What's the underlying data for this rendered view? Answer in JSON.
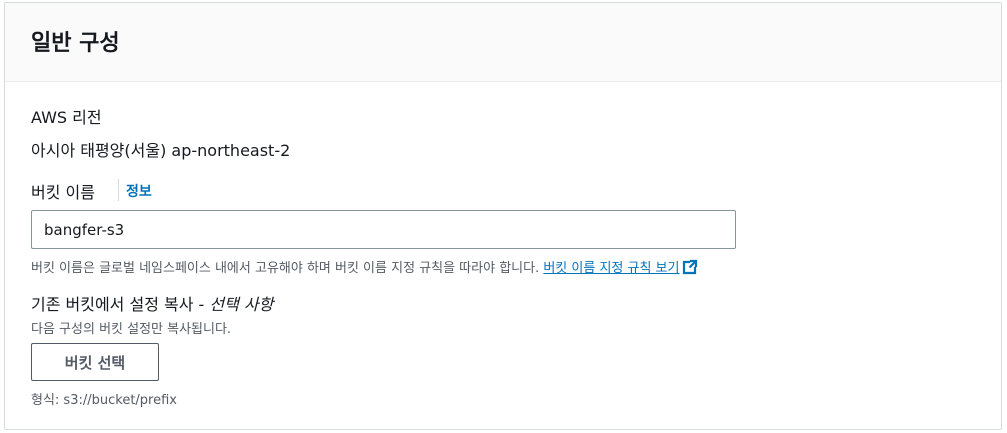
{
  "panel": {
    "title": "일반 구성"
  },
  "region": {
    "label": "AWS 리전",
    "value": "아시아 태평양(서울) ap-northeast-2"
  },
  "bucket_name": {
    "label": "버킷 이름",
    "info_link": "정보",
    "value": "bangfer-s3",
    "hint_text": "버킷 이름은 글로벌 네임스페이스 내에서 고유해야 하며 버킷 이름 지정 규칙을 따라야 합니다. ",
    "hint_link": "버킷 이름 지정 규칙 보기",
    "hint_link_icon": "external-link-icon"
  },
  "copy_settings": {
    "label_main": "기존 버킷에서 설정 복사 - ",
    "label_optional": "선택 사항",
    "description": "다음 구성의 버킷 설정만 복사됩니다.",
    "button_label": "버킷 선택",
    "format_hint": "형식: s3://bucket/prefix"
  },
  "colors": {
    "link": "#0073bb",
    "text": "#16191f",
    "secondary_text": "#545b64",
    "header_bg": "#fafafa",
    "border": "#d5dbdb"
  }
}
